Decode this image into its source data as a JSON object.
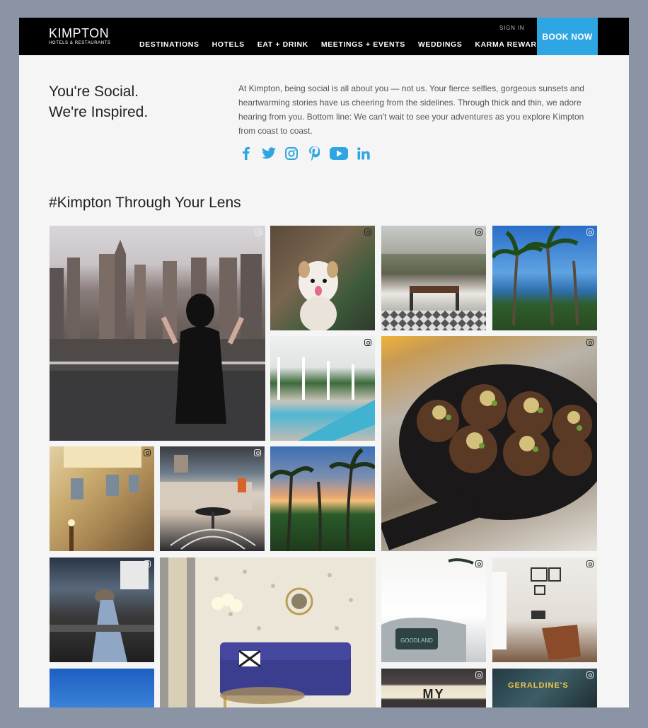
{
  "header": {
    "logo_main": "KIMPTON",
    "logo_sub": "HOTELS & RESTAURANTS",
    "sign_in": "SIGN IN",
    "book_now": "BOOK NOW",
    "nav": [
      "DESTINATIONS",
      "HOTELS",
      "EAT + DRINK",
      "MEETINGS + EVENTS",
      "WEDDINGS",
      "KARMA REWARDS"
    ]
  },
  "intro": {
    "headline_line1": "You're Social.",
    "headline_line2": "We're Inspired.",
    "body": "At Kimpton, being social is all about you — not us. Your fierce selfies, gorgeous sunsets and heartwarming stories have us cheering from the sidelines. Through thick and thin, we adore hearing from you. Bottom line: We can't wait to see your adventures as you explore Kimpton from coast to coast.",
    "social_icons": [
      "facebook-icon",
      "twitter-icon",
      "instagram-icon",
      "pinterest-icon",
      "youtube-icon",
      "linkedin-icon"
    ]
  },
  "gallery": {
    "title": "#Kimpton Through Your Lens",
    "tiles": [
      {
        "subject": "city-skyline-woman",
        "text": ""
      },
      {
        "subject": "white-dog",
        "text": ""
      },
      {
        "subject": "restaurant-patio",
        "text": ""
      },
      {
        "subject": "palm-trees-ocean",
        "text": ""
      },
      {
        "subject": "pool-cabanas",
        "text": ""
      },
      {
        "subject": "skillet-meatballs",
        "text": ""
      },
      {
        "subject": "ornate-ceiling",
        "text": ""
      },
      {
        "subject": "lounge-living-room",
        "text": ""
      },
      {
        "subject": "sunset-palms",
        "text": ""
      },
      {
        "subject": "city-shoes-feet",
        "text": ""
      },
      {
        "subject": "wallpaper-blue-sofa",
        "text": ""
      },
      {
        "subject": "airstream-trailer",
        "text": ""
      },
      {
        "subject": "hotel-room-chair",
        "text": ""
      },
      {
        "subject": "blue-sky",
        "text": ""
      },
      {
        "subject": "marquee-sign",
        "text": "MY"
      },
      {
        "subject": "geraldines-neon",
        "text": "GERALDINE'S"
      }
    ]
  },
  "colors": {
    "accent": "#2fa6e4",
    "header_bg": "#000000",
    "page_bg": "#f5f5f5",
    "frame_bg": "#8a94a4"
  }
}
